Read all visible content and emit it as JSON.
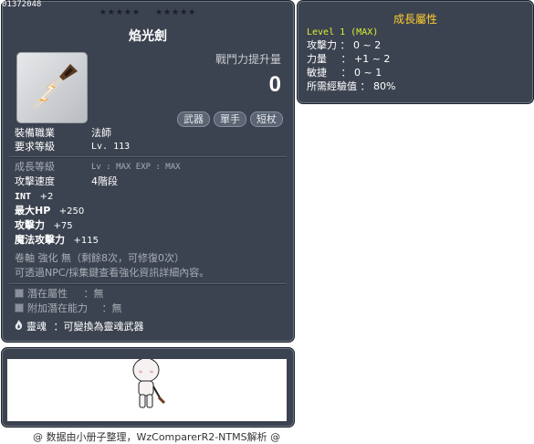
{
  "item_id": "01372048",
  "item": {
    "stars_group1": "★★★★★",
    "stars_group2": "★★★★★",
    "name": "焰光劍",
    "combat_power_label": "戰鬥力提升量",
    "combat_power_value": "0",
    "tags": [
      "武器",
      "單手",
      "短杖"
    ],
    "required_job_label": "裝備職業",
    "required_job_value": "法師",
    "required_level_label": "要求等級",
    "required_level_value": "Lv. 113",
    "growth_level_label": "成長等級",
    "growth_level_value": "Lv : MAX  EXP : MAX",
    "attack_speed_label": "攻擊速度",
    "attack_speed_value": "4階段",
    "stats": [
      {
        "label": "INT",
        "value": "+2"
      },
      {
        "label": "最大HP",
        "value": "+250"
      },
      {
        "label": "攻擊力",
        "value": "+75"
      },
      {
        "label": "魔法攻擊力",
        "value": "+115"
      }
    ],
    "scroll_line": "卷軸 強化 無（剩餘8次，可修復0次）",
    "npc_line": "可透過NPC/採集鍵查看強化資訊詳細內容。",
    "potential_label": "潛在屬性",
    "potential_value": "：無",
    "additional_potential_label": "附加潛在能力",
    "additional_potential_value": "：無",
    "soul_label": "靈魂",
    "soul_value": "：可變換為靈魂武器"
  },
  "growth_panel": {
    "title": "成長屬性",
    "level_line": "Level 1 (MAX)",
    "rows": [
      {
        "label": "攻擊力",
        "value": "： 0 ~ 2"
      },
      {
        "label": "力量",
        "value": "： +1 ~ 2"
      },
      {
        "label": "敏捷",
        "value": "： 0 ~ 1"
      },
      {
        "label": "所需經驗值",
        "value": "： 80%"
      }
    ]
  },
  "footer": "@ 数据由小册子整理，WzComparerR2-NTMS解析 @",
  "colors": {
    "panel_bg": "#3c4350",
    "title_gold": "#ffcc2f",
    "level_green": "#d6ee33",
    "text_white": "#ffffff",
    "text_gray": "#a8adb5"
  }
}
